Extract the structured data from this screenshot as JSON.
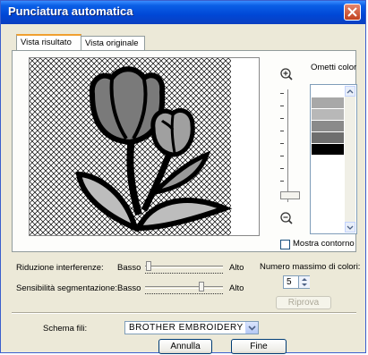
{
  "window": {
    "title": "Punciatura automatica"
  },
  "tabs": [
    {
      "label": "Vista risultato",
      "active": true
    },
    {
      "label": "Vista originale",
      "active": false
    }
  ],
  "preview": {
    "icons": [
      "zoom-in-icon",
      "zoom-out-icon"
    ]
  },
  "colors_panel": {
    "label": "Ometti color",
    "swatches": [
      "#ffffff",
      "#a8a8a8",
      "#b8b8b8",
      "#8a8a8a",
      "#6e6e6e",
      "#000000"
    ],
    "show_outline_label": "Mostra contorno",
    "show_outline_checked": false
  },
  "interference": {
    "label": "Riduzione interferenze:",
    "low": "Basso",
    "high": "Alto",
    "value_fraction": 0.05
  },
  "segmentation": {
    "label": "Sensibilità segmentazione:",
    "low": "Basso",
    "high": "Alto",
    "value_fraction": 0.72
  },
  "max_colors": {
    "label": "Numero massimo di colori:",
    "value": "5"
  },
  "retry_button": "Riprova",
  "thread_scheme": {
    "label": "Schema fili:",
    "value": "BROTHER EMBROIDERY"
  },
  "buttons": {
    "cancel": "Annulla",
    "finish": "Fine"
  },
  "accent_colors": {
    "titlebar": "#0a5fe6",
    "tab_highlight": "#f0a030"
  }
}
